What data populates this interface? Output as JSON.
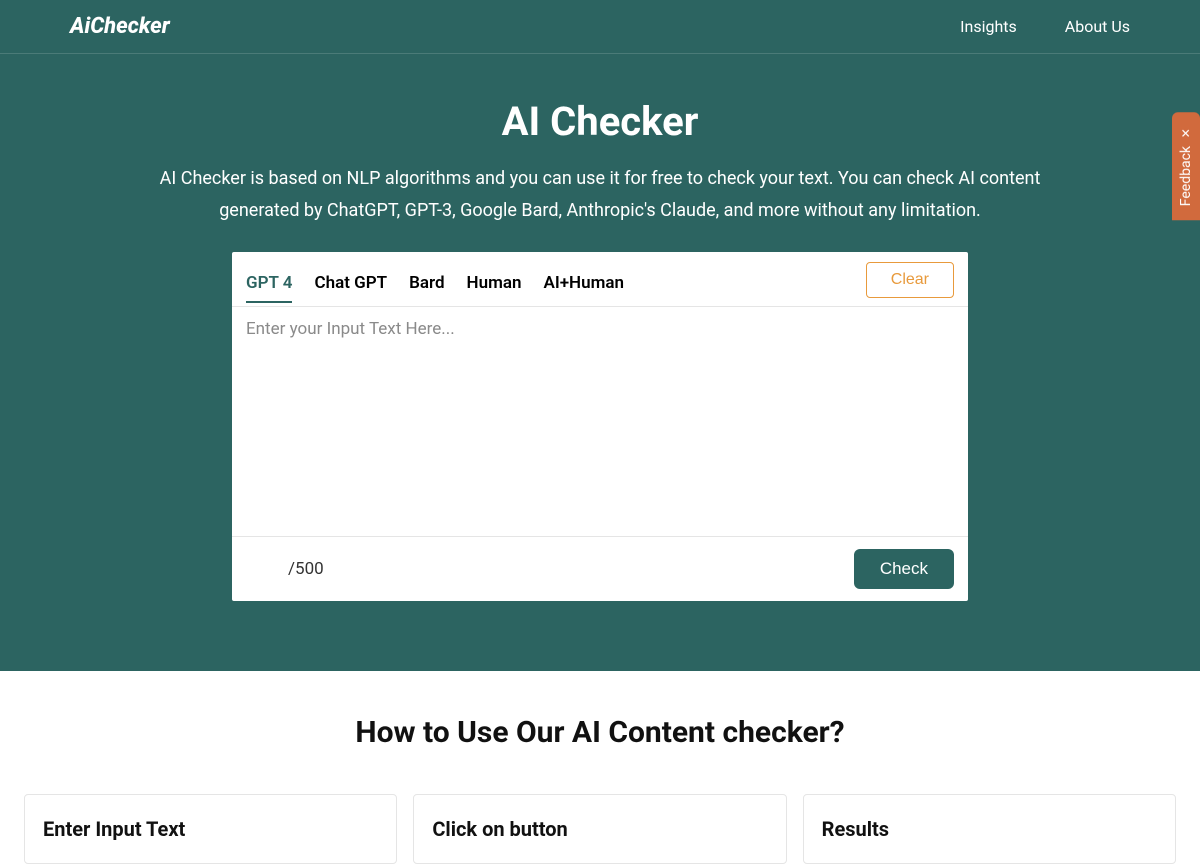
{
  "header": {
    "logo": "AiChecker",
    "nav": {
      "insights": "Insights",
      "about": "About Us"
    }
  },
  "hero": {
    "title": "AI Checker",
    "subtitle": "AI Checker is based on NLP algorithms and you can use it for free to check your text. You can check AI content generated by ChatGPT, GPT-3, Google Bard, Anthropic's Claude, and more without any limitation."
  },
  "tabs": [
    {
      "label": "GPT 4",
      "active": true
    },
    {
      "label": "Chat GPT",
      "active": false
    },
    {
      "label": "Bard",
      "active": false
    },
    {
      "label": "Human",
      "active": false
    },
    {
      "label": "AI+Human",
      "active": false
    }
  ],
  "buttons": {
    "clear": "Clear",
    "check": "Check"
  },
  "input": {
    "placeholder": "Enter your Input Text Here...",
    "value": ""
  },
  "counter": "/500",
  "howto": {
    "title": "How to Use Our AI Content checker?",
    "cards": [
      {
        "title": "Enter Input Text"
      },
      {
        "title": "Click on button"
      },
      {
        "title": "Results"
      }
    ]
  },
  "feedback": "Feedback"
}
